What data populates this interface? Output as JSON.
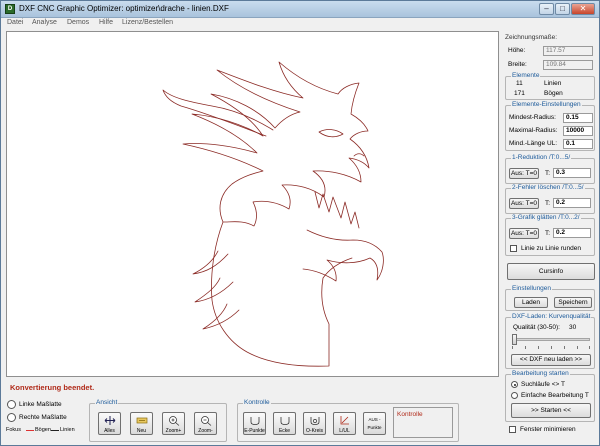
{
  "window": {
    "title": "DXF CNC Graphic Optimizer: optimizer\\drache - linien.DXF",
    "app_icon": "dxf-app-icon",
    "controls": [
      "minimize",
      "maximize",
      "close"
    ]
  },
  "menu": [
    "Datei",
    "Analyse",
    "Demos",
    "Hilfe",
    "Lizenz/Bestellen"
  ],
  "status_message": "Konvertierung beendet.",
  "side": {
    "drawing_size": {
      "title": "Zeichnungsmaße:",
      "height_label": "Höhe:",
      "height_value": "117.57",
      "width_label": "Breite:",
      "width_value": "109.84"
    },
    "elements": {
      "title": "Elemente",
      "lines_count": "11",
      "lines_label": "Linien",
      "arcs_count": "171",
      "arcs_label": "Bögen"
    },
    "element_settings": {
      "title": "Elemente-Einstellungen",
      "min_radius_label": "Mindest-Radius:",
      "min_radius_value": "0.15",
      "max_radius_label": "Maximal-Radius:",
      "max_radius_value": "10000",
      "min_length_label": "Mind.-Länge UL:",
      "min_length_value": "0.1"
    },
    "reduction": {
      "title": "1-Reduktion  /T:0...5/",
      "button": "Aus: T=0",
      "t_label": "T:",
      "t_value": "0.3"
    },
    "error_delete": {
      "title": "2-Fehler löschen /T:0...5/",
      "button": "Aus: T=0",
      "t_label": "T:",
      "t_value": "0.2"
    },
    "smooth": {
      "title": "3-Grafik glätten  /T:0...2/",
      "button": "Aus: T=0",
      "t_label": "T:",
      "t_value": "0.2",
      "round_checkbox_label": "Linie zu Linie runden",
      "round_checked": false
    },
    "cursinfo_button": "Cursinfo",
    "settings": {
      "title": "Einstellungen",
      "load_button": "Laden",
      "save_button": "Speichern"
    },
    "dxf_load": {
      "title": "DXF-Laden: Kurvenqualität",
      "quality_label": "Qualität (30-50):",
      "quality_value": "30",
      "quality_fraction": 0.0,
      "reload_button": "<< DXF neu laden >>"
    },
    "processing": {
      "title": "Bearbeitung starten",
      "option_search": "Suchläufe <> T",
      "option_simple": "Einfache Bearbeitung T",
      "selected": "search",
      "start_button": ">> Starten <<",
      "minimize_checkbox_label": "Fenster minimieren",
      "minimize_checked": false
    }
  },
  "bottom": {
    "left_dim_label": "Linke Maßlatte",
    "right_dim_label": "Rechte Maßlatte",
    "legend_focus": "Fokus",
    "legend_arcs": "Bögen",
    "legend_lines": "Linien",
    "view": {
      "title": "Ansicht",
      "buttons": [
        "Alles",
        "Neu",
        "Zoom+",
        "Zoom-"
      ]
    },
    "control": {
      "title": "Kontrolle",
      "buttons": [
        "E-Punkte",
        "Ecke",
        "O-Kreis",
        "L/UL",
        "AUS - Punkte"
      ],
      "panel_label": "Kontrolle"
    }
  },
  "colors": {
    "drawing_stroke": "#8b2a25",
    "group_title": "#1c5a9a",
    "status_text": "#b02a19"
  }
}
